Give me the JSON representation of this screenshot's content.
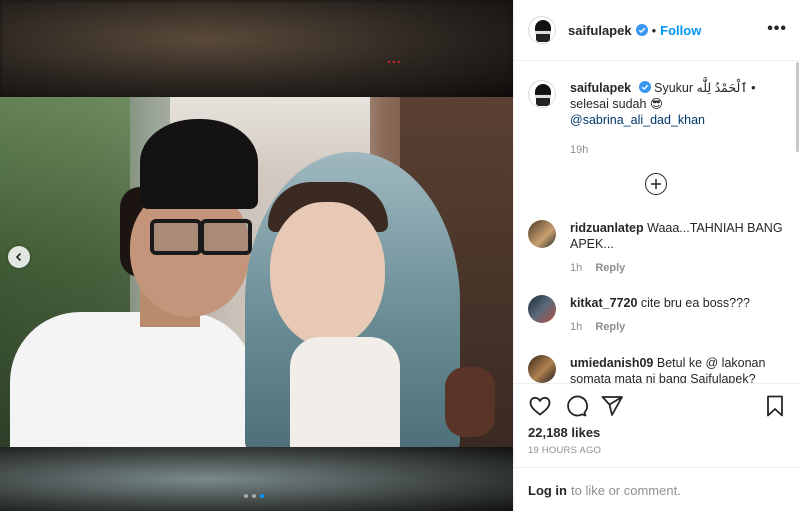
{
  "post": {
    "username": "saifulapek",
    "bullet": "•",
    "follow_label": "Follow",
    "more_label": "•••",
    "red_dots": "..."
  },
  "caption": {
    "username": "saifulapek",
    "text": "Syukur ٱلْحَمْدُ لِلَّٰه • selesai sudah 😎",
    "mention": "@sabrina_ali_dad_khan",
    "age": "19h"
  },
  "comments": [
    {
      "username": "ridzuanlatep",
      "text": "Waaa...TAHNIAH BANG APEK...",
      "age": "1h",
      "reply_label": "Reply"
    },
    {
      "username": "kitkat_7720",
      "text": "cite bru ea boss???",
      "age": "1h",
      "reply_label": "Reply"
    },
    {
      "username": "umiedanish09",
      "text": "Betul ke @ lakonan somata mata ni bang Saifulapek?",
      "age": "",
      "reply_label": ""
    }
  ],
  "footer": {
    "likes": "22,188 likes",
    "timestamp": "19 HOURS AGO",
    "login_link": "Log in",
    "login_rest": "to like or comment."
  },
  "icons": {
    "prev": "chevron-left-icon",
    "like": "heart-icon",
    "comment": "comment-icon",
    "share": "share-icon",
    "save": "bookmark-icon",
    "load_more": "plus-circle-icon",
    "verified": "verified-badge-icon"
  },
  "carousel": {
    "count": 3,
    "active_index": 2
  },
  "colors": {
    "accent": "#0095f6",
    "verified": "#3897f0",
    "muted": "#8e8e8e",
    "red_dots": "#d9252a"
  }
}
